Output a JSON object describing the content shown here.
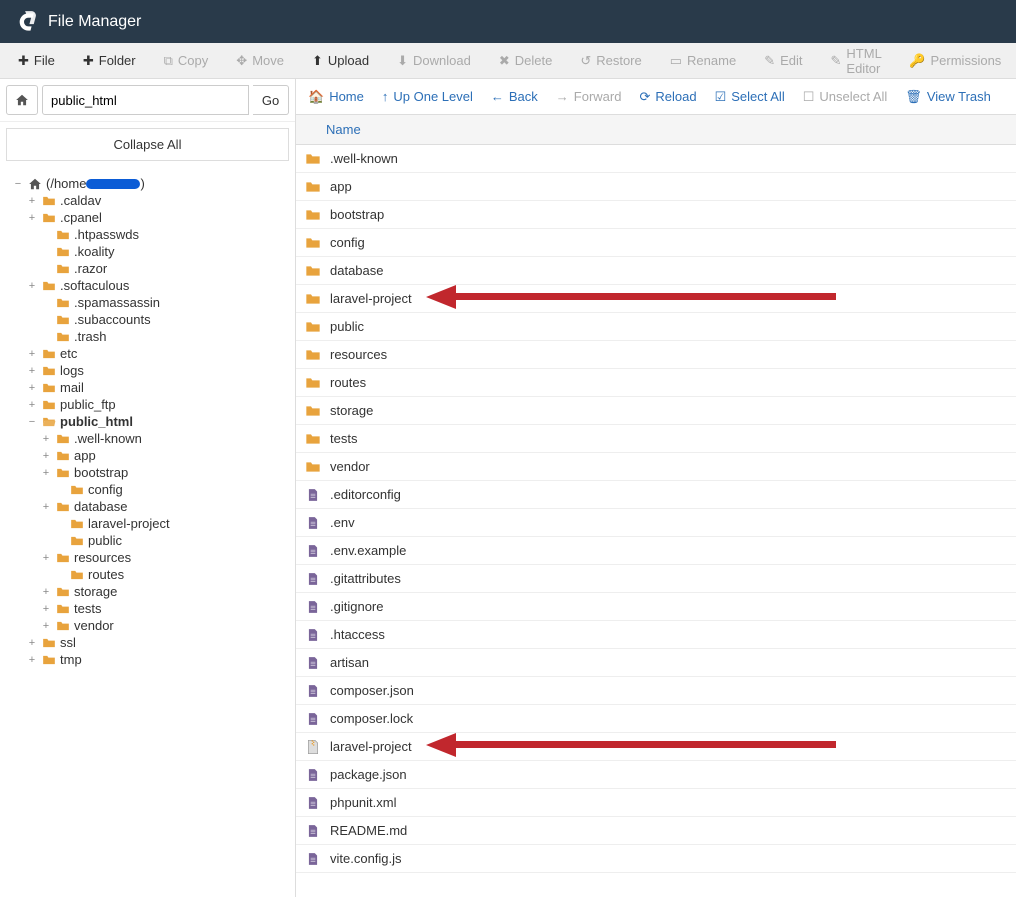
{
  "header": {
    "title": "File Manager"
  },
  "toolbar": {
    "file": "File",
    "folder": "Folder",
    "copy": "Copy",
    "move": "Move",
    "upload": "Upload",
    "download": "Download",
    "delete": "Delete",
    "restore": "Restore",
    "rename": "Rename",
    "edit": "Edit",
    "html_editor": "HTML Editor",
    "permissions": "Permissions"
  },
  "sidebar": {
    "path_value": "public_html",
    "go_label": "Go",
    "collapse_label": "Collapse All",
    "root_label": "(/home",
    "root_suffix": ")"
  },
  "tree": [
    {
      "depth": 0,
      "toggle": "−",
      "icon": "home",
      "label": "(/home",
      "redact": true,
      "suffix": ")"
    },
    {
      "depth": 1,
      "toggle": "+",
      "icon": "folder",
      "label": ".caldav"
    },
    {
      "depth": 1,
      "toggle": "+",
      "icon": "folder",
      "label": ".cpanel"
    },
    {
      "depth": 2,
      "toggle": "",
      "icon": "folder",
      "label": ".htpasswds"
    },
    {
      "depth": 2,
      "toggle": "",
      "icon": "folder",
      "label": ".koality"
    },
    {
      "depth": 2,
      "toggle": "",
      "icon": "folder",
      "label": ".razor"
    },
    {
      "depth": 1,
      "toggle": "+",
      "icon": "folder",
      "label": ".softaculous"
    },
    {
      "depth": 2,
      "toggle": "",
      "icon": "folder",
      "label": ".spamassassin"
    },
    {
      "depth": 2,
      "toggle": "",
      "icon": "folder",
      "label": ".subaccounts"
    },
    {
      "depth": 2,
      "toggle": "",
      "icon": "folder",
      "label": ".trash"
    },
    {
      "depth": 1,
      "toggle": "+",
      "icon": "folder",
      "label": "etc"
    },
    {
      "depth": 1,
      "toggle": "+",
      "icon": "folder",
      "label": "logs"
    },
    {
      "depth": 1,
      "toggle": "+",
      "icon": "folder",
      "label": "mail"
    },
    {
      "depth": 1,
      "toggle": "+",
      "icon": "folder",
      "label": "public_ftp"
    },
    {
      "depth": 1,
      "toggle": "−",
      "icon": "folder-open",
      "label": "public_html",
      "bold": true
    },
    {
      "depth": 2,
      "toggle": "+",
      "icon": "folder",
      "label": ".well-known"
    },
    {
      "depth": 2,
      "toggle": "+",
      "icon": "folder",
      "label": "app"
    },
    {
      "depth": 2,
      "toggle": "+",
      "icon": "folder",
      "label": "bootstrap"
    },
    {
      "depth": 3,
      "toggle": "",
      "icon": "folder",
      "label": "config"
    },
    {
      "depth": 2,
      "toggle": "+",
      "icon": "folder",
      "label": "database"
    },
    {
      "depth": 3,
      "toggle": "",
      "icon": "folder",
      "label": "laravel-project"
    },
    {
      "depth": 3,
      "toggle": "",
      "icon": "folder",
      "label": "public"
    },
    {
      "depth": 2,
      "toggle": "+",
      "icon": "folder",
      "label": "resources"
    },
    {
      "depth": 3,
      "toggle": "",
      "icon": "folder",
      "label": "routes"
    },
    {
      "depth": 2,
      "toggle": "+",
      "icon": "folder",
      "label": "storage"
    },
    {
      "depth": 2,
      "toggle": "+",
      "icon": "folder",
      "label": "tests"
    },
    {
      "depth": 2,
      "toggle": "+",
      "icon": "folder",
      "label": "vendor"
    },
    {
      "depth": 1,
      "toggle": "+",
      "icon": "folder",
      "label": "ssl"
    },
    {
      "depth": 1,
      "toggle": "+",
      "icon": "folder",
      "label": "tmp"
    }
  ],
  "nav": {
    "home": "Home",
    "up": "Up One Level",
    "back": "Back",
    "forward": "Forward",
    "reload": "Reload",
    "select_all": "Select All",
    "unselect_all": "Unselect All",
    "view_trash": "View Trash"
  },
  "list_header": {
    "name": "Name"
  },
  "files": [
    {
      "type": "folder",
      "name": ".well-known"
    },
    {
      "type": "folder",
      "name": "app"
    },
    {
      "type": "folder",
      "name": "bootstrap"
    },
    {
      "type": "folder",
      "name": "config"
    },
    {
      "type": "folder",
      "name": "database"
    },
    {
      "type": "folder",
      "name": "laravel-project"
    },
    {
      "type": "folder",
      "name": "public"
    },
    {
      "type": "folder",
      "name": "resources"
    },
    {
      "type": "folder",
      "name": "routes"
    },
    {
      "type": "folder",
      "name": "storage"
    },
    {
      "type": "folder",
      "name": "tests"
    },
    {
      "type": "folder",
      "name": "vendor"
    },
    {
      "type": "file",
      "name": ".editorconfig"
    },
    {
      "type": "file",
      "name": ".env"
    },
    {
      "type": "file",
      "name": ".env.example"
    },
    {
      "type": "file",
      "name": ".gitattributes"
    },
    {
      "type": "file",
      "name": ".gitignore"
    },
    {
      "type": "file",
      "name": ".htaccess"
    },
    {
      "type": "file",
      "name": "artisan"
    },
    {
      "type": "file",
      "name": "composer.json"
    },
    {
      "type": "file",
      "name": "composer.lock"
    },
    {
      "type": "zip",
      "name": "laravel-project"
    },
    {
      "type": "file",
      "name": "package.json"
    },
    {
      "type": "file",
      "name": "phpunit.xml"
    },
    {
      "type": "file",
      "name": "README.md"
    },
    {
      "type": "file",
      "name": "vite.config.js"
    }
  ],
  "arrows": [
    {
      "target": "laravel-project",
      "row": 5
    },
    {
      "target": "laravel-project",
      "row": 21
    }
  ]
}
